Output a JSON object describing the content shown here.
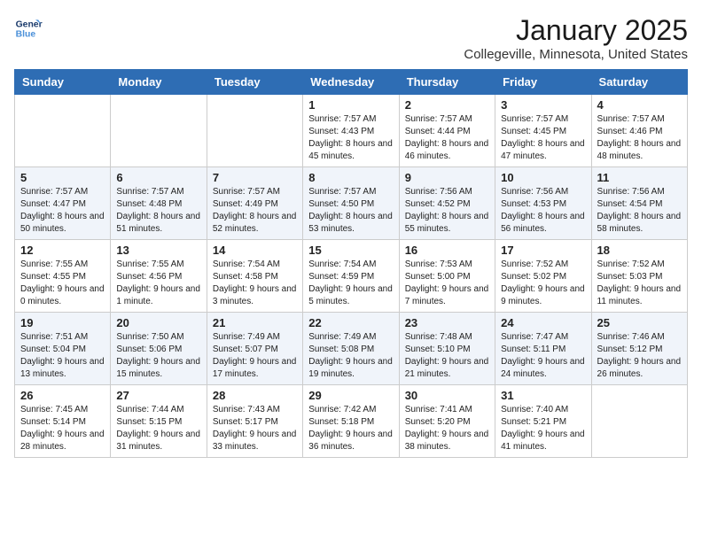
{
  "header": {
    "logo_line1": "General",
    "logo_line2": "Blue",
    "month": "January 2025",
    "location": "Collegeville, Minnesota, United States"
  },
  "weekdays": [
    "Sunday",
    "Monday",
    "Tuesday",
    "Wednesday",
    "Thursday",
    "Friday",
    "Saturday"
  ],
  "weeks": [
    [
      {
        "day": "",
        "info": ""
      },
      {
        "day": "",
        "info": ""
      },
      {
        "day": "",
        "info": ""
      },
      {
        "day": "1",
        "info": "Sunrise: 7:57 AM\nSunset: 4:43 PM\nDaylight: 8 hours and 45 minutes."
      },
      {
        "day": "2",
        "info": "Sunrise: 7:57 AM\nSunset: 4:44 PM\nDaylight: 8 hours and 46 minutes."
      },
      {
        "day": "3",
        "info": "Sunrise: 7:57 AM\nSunset: 4:45 PM\nDaylight: 8 hours and 47 minutes."
      },
      {
        "day": "4",
        "info": "Sunrise: 7:57 AM\nSunset: 4:46 PM\nDaylight: 8 hours and 48 minutes."
      }
    ],
    [
      {
        "day": "5",
        "info": "Sunrise: 7:57 AM\nSunset: 4:47 PM\nDaylight: 8 hours and 50 minutes."
      },
      {
        "day": "6",
        "info": "Sunrise: 7:57 AM\nSunset: 4:48 PM\nDaylight: 8 hours and 51 minutes."
      },
      {
        "day": "7",
        "info": "Sunrise: 7:57 AM\nSunset: 4:49 PM\nDaylight: 8 hours and 52 minutes."
      },
      {
        "day": "8",
        "info": "Sunrise: 7:57 AM\nSunset: 4:50 PM\nDaylight: 8 hours and 53 minutes."
      },
      {
        "day": "9",
        "info": "Sunrise: 7:56 AM\nSunset: 4:52 PM\nDaylight: 8 hours and 55 minutes."
      },
      {
        "day": "10",
        "info": "Sunrise: 7:56 AM\nSunset: 4:53 PM\nDaylight: 8 hours and 56 minutes."
      },
      {
        "day": "11",
        "info": "Sunrise: 7:56 AM\nSunset: 4:54 PM\nDaylight: 8 hours and 58 minutes."
      }
    ],
    [
      {
        "day": "12",
        "info": "Sunrise: 7:55 AM\nSunset: 4:55 PM\nDaylight: 9 hours and 0 minutes."
      },
      {
        "day": "13",
        "info": "Sunrise: 7:55 AM\nSunset: 4:56 PM\nDaylight: 9 hours and 1 minute."
      },
      {
        "day": "14",
        "info": "Sunrise: 7:54 AM\nSunset: 4:58 PM\nDaylight: 9 hours and 3 minutes."
      },
      {
        "day": "15",
        "info": "Sunrise: 7:54 AM\nSunset: 4:59 PM\nDaylight: 9 hours and 5 minutes."
      },
      {
        "day": "16",
        "info": "Sunrise: 7:53 AM\nSunset: 5:00 PM\nDaylight: 9 hours and 7 minutes."
      },
      {
        "day": "17",
        "info": "Sunrise: 7:52 AM\nSunset: 5:02 PM\nDaylight: 9 hours and 9 minutes."
      },
      {
        "day": "18",
        "info": "Sunrise: 7:52 AM\nSunset: 5:03 PM\nDaylight: 9 hours and 11 minutes."
      }
    ],
    [
      {
        "day": "19",
        "info": "Sunrise: 7:51 AM\nSunset: 5:04 PM\nDaylight: 9 hours and 13 minutes."
      },
      {
        "day": "20",
        "info": "Sunrise: 7:50 AM\nSunset: 5:06 PM\nDaylight: 9 hours and 15 minutes."
      },
      {
        "day": "21",
        "info": "Sunrise: 7:49 AM\nSunset: 5:07 PM\nDaylight: 9 hours and 17 minutes."
      },
      {
        "day": "22",
        "info": "Sunrise: 7:49 AM\nSunset: 5:08 PM\nDaylight: 9 hours and 19 minutes."
      },
      {
        "day": "23",
        "info": "Sunrise: 7:48 AM\nSunset: 5:10 PM\nDaylight: 9 hours and 21 minutes."
      },
      {
        "day": "24",
        "info": "Sunrise: 7:47 AM\nSunset: 5:11 PM\nDaylight: 9 hours and 24 minutes."
      },
      {
        "day": "25",
        "info": "Sunrise: 7:46 AM\nSunset: 5:12 PM\nDaylight: 9 hours and 26 minutes."
      }
    ],
    [
      {
        "day": "26",
        "info": "Sunrise: 7:45 AM\nSunset: 5:14 PM\nDaylight: 9 hours and 28 minutes."
      },
      {
        "day": "27",
        "info": "Sunrise: 7:44 AM\nSunset: 5:15 PM\nDaylight: 9 hours and 31 minutes."
      },
      {
        "day": "28",
        "info": "Sunrise: 7:43 AM\nSunset: 5:17 PM\nDaylight: 9 hours and 33 minutes."
      },
      {
        "day": "29",
        "info": "Sunrise: 7:42 AM\nSunset: 5:18 PM\nDaylight: 9 hours and 36 minutes."
      },
      {
        "day": "30",
        "info": "Sunrise: 7:41 AM\nSunset: 5:20 PM\nDaylight: 9 hours and 38 minutes."
      },
      {
        "day": "31",
        "info": "Sunrise: 7:40 AM\nSunset: 5:21 PM\nDaylight: 9 hours and 41 minutes."
      },
      {
        "day": "",
        "info": ""
      }
    ]
  ]
}
